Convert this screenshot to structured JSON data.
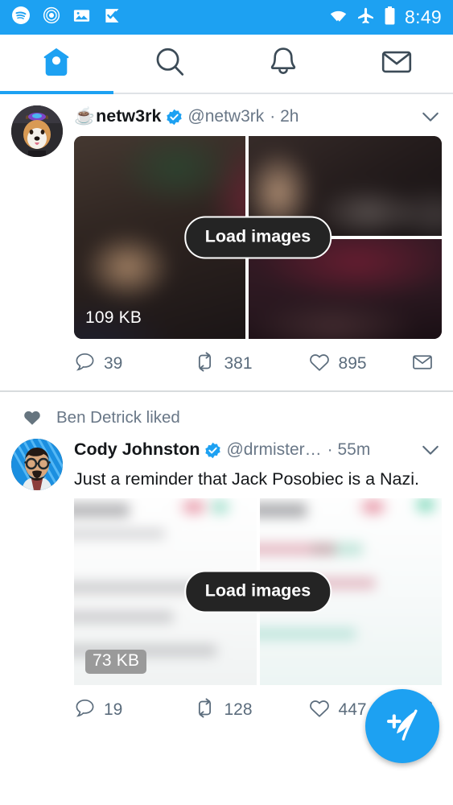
{
  "status_bar": {
    "time": "8:49",
    "left_icons": [
      "spotify-icon",
      "shazam-icon",
      "photo-icon",
      "checkmark-flag-icon"
    ],
    "right_icons": [
      "wifi-data-icon",
      "airplane-mode-icon",
      "battery-icon"
    ],
    "background_color": "#1DA1F2"
  },
  "nav": {
    "accent_color": "#1DA1F2",
    "tabs": [
      {
        "name": "home",
        "icon": "home-icon",
        "active": true
      },
      {
        "name": "search",
        "icon": "search-icon",
        "active": false
      },
      {
        "name": "notifications",
        "icon": "bell-icon",
        "active": false
      },
      {
        "name": "messages",
        "icon": "envelope-icon",
        "active": false
      }
    ]
  },
  "feed": {
    "tweets": [
      {
        "avatar": "corgi-dog-photo",
        "emoji": "☕",
        "display_name": "netw3rk",
        "verified": true,
        "handle": "@netw3rk",
        "separator": "·",
        "timestamp": "2h",
        "text": "",
        "media": {
          "layout": "three-grid",
          "size_label": "109 KB",
          "size_label_style": "plain",
          "load_button": "Load images",
          "theme": "dark"
        },
        "actions": {
          "reply": "39",
          "retweet": "381",
          "like": "895",
          "share_icon": "envelope-icon"
        }
      },
      {
        "context": {
          "icon": "heart-filled-icon",
          "label": "Ben Detrick liked"
        },
        "avatar": "illustrated-bearded-man",
        "emoji": "",
        "display_name": "Cody Johnston",
        "verified": true,
        "handle": "@drmister…",
        "separator": "·",
        "timestamp": "55m",
        "text": "Just a reminder that Jack Posobiec is a Nazi.",
        "media": {
          "layout": "two-grid",
          "size_label": "73 KB",
          "size_label_style": "badge",
          "load_button": "Load images",
          "theme": "light"
        },
        "actions": {
          "reply": "19",
          "retweet": "128",
          "like": "447",
          "share_icon": "envelope-icon"
        }
      }
    ]
  },
  "fab": {
    "icon": "compose-feather-icon",
    "color": "#1DA1F2"
  }
}
